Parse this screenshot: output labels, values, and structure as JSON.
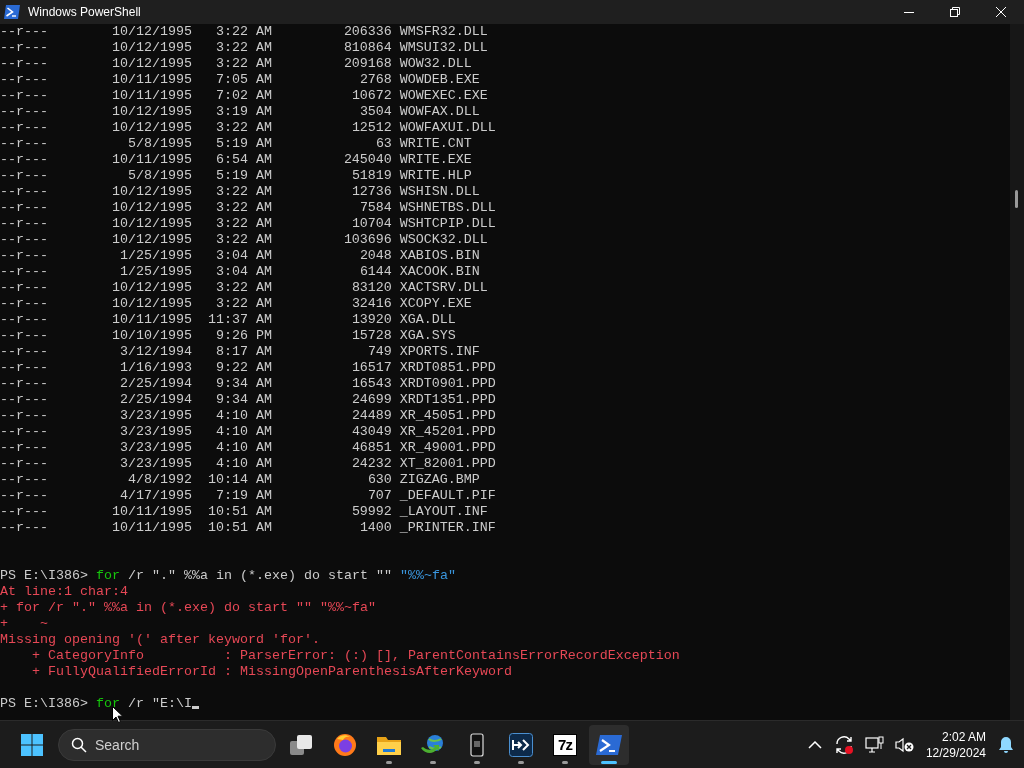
{
  "window": {
    "title": "Windows PowerShell"
  },
  "listing": [
    {
      "mode": "--r---",
      "date": "10/12/1995",
      "time": "3:22 AM",
      "length": "206336",
      "name": "WMSFR32.DLL"
    },
    {
      "mode": "--r---",
      "date": "10/12/1995",
      "time": "3:22 AM",
      "length": "810864",
      "name": "WMSUI32.DLL"
    },
    {
      "mode": "--r---",
      "date": "10/12/1995",
      "time": "3:22 AM",
      "length": "209168",
      "name": "WOW32.DLL"
    },
    {
      "mode": "--r---",
      "date": "10/11/1995",
      "time": "7:05 AM",
      "length": "2768",
      "name": "WOWDEB.EXE"
    },
    {
      "mode": "--r---",
      "date": "10/11/1995",
      "time": "7:02 AM",
      "length": "10672",
      "name": "WOWEXEC.EXE"
    },
    {
      "mode": "--r---",
      "date": "10/12/1995",
      "time": "3:19 AM",
      "length": "3504",
      "name": "WOWFAX.DLL"
    },
    {
      "mode": "--r---",
      "date": "10/12/1995",
      "time": "3:22 AM",
      "length": "12512",
      "name": "WOWFAXUI.DLL"
    },
    {
      "mode": "--r---",
      "date": "5/8/1995",
      "time": "5:19 AM",
      "length": "63",
      "name": "WRITE.CNT"
    },
    {
      "mode": "--r---",
      "date": "10/11/1995",
      "time": "6:54 AM",
      "length": "245040",
      "name": "WRITE.EXE"
    },
    {
      "mode": "--r---",
      "date": "5/8/1995",
      "time": "5:19 AM",
      "length": "51819",
      "name": "WRITE.HLP"
    },
    {
      "mode": "--r---",
      "date": "10/12/1995",
      "time": "3:22 AM",
      "length": "12736",
      "name": "WSHISN.DLL"
    },
    {
      "mode": "--r---",
      "date": "10/12/1995",
      "time": "3:22 AM",
      "length": "7584",
      "name": "WSHNETBS.DLL"
    },
    {
      "mode": "--r---",
      "date": "10/12/1995",
      "time": "3:22 AM",
      "length": "10704",
      "name": "WSHTCPIP.DLL"
    },
    {
      "mode": "--r---",
      "date": "10/12/1995",
      "time": "3:22 AM",
      "length": "103696",
      "name": "WSOCK32.DLL"
    },
    {
      "mode": "--r---",
      "date": "1/25/1995",
      "time": "3:04 AM",
      "length": "2048",
      "name": "XABIOS.BIN"
    },
    {
      "mode": "--r---",
      "date": "1/25/1995",
      "time": "3:04 AM",
      "length": "6144",
      "name": "XACOOK.BIN"
    },
    {
      "mode": "--r---",
      "date": "10/12/1995",
      "time": "3:22 AM",
      "length": "83120",
      "name": "XACTSRV.DLL"
    },
    {
      "mode": "--r---",
      "date": "10/12/1995",
      "time": "3:22 AM",
      "length": "32416",
      "name": "XCOPY.EXE"
    },
    {
      "mode": "--r---",
      "date": "10/11/1995",
      "time": "11:37 AM",
      "length": "13920",
      "name": "XGA.DLL"
    },
    {
      "mode": "--r---",
      "date": "10/10/1995",
      "time": "9:26 PM",
      "length": "15728",
      "name": "XGA.SYS"
    },
    {
      "mode": "--r---",
      "date": "3/12/1994",
      "time": "8:17 AM",
      "length": "749",
      "name": "XPORTS.INF"
    },
    {
      "mode": "--r---",
      "date": "1/16/1993",
      "time": "9:22 AM",
      "length": "16517",
      "name": "XRDT0851.PPD"
    },
    {
      "mode": "--r---",
      "date": "2/25/1994",
      "time": "9:34 AM",
      "length": "16543",
      "name": "XRDT0901.PPD"
    },
    {
      "mode": "--r---",
      "date": "2/25/1994",
      "time": "9:34 AM",
      "length": "24699",
      "name": "XRDT1351.PPD"
    },
    {
      "mode": "--r---",
      "date": "3/23/1995",
      "time": "4:10 AM",
      "length": "24489",
      "name": "XR_45051.PPD"
    },
    {
      "mode": "--r---",
      "date": "3/23/1995",
      "time": "4:10 AM",
      "length": "43049",
      "name": "XR_45201.PPD"
    },
    {
      "mode": "--r---",
      "date": "3/23/1995",
      "time": "4:10 AM",
      "length": "46851",
      "name": "XR_49001.PPD"
    },
    {
      "mode": "--r---",
      "date": "3/23/1995",
      "time": "4:10 AM",
      "length": "24232",
      "name": "XT_82001.PPD"
    },
    {
      "mode": "--r---",
      "date": "4/8/1992",
      "time": "10:14 AM",
      "length": "630",
      "name": "ZIGZAG.BMP"
    },
    {
      "mode": "--r---",
      "date": "4/17/1995",
      "time": "7:19 AM",
      "length": "707",
      "name": "_DEFAULT.PIF"
    },
    {
      "mode": "--r---",
      "date": "10/11/1995",
      "time": "10:51 AM",
      "length": "59992",
      "name": "_LAYOUT.INF"
    },
    {
      "mode": "--r---",
      "date": "10/11/1995",
      "time": "10:51 AM",
      "length": "1400",
      "name": "_PRINTER.INF"
    }
  ],
  "session": [
    {
      "kind": "command",
      "segments": [
        {
          "text": "PS E:\\I386> ",
          "color": "#cccccc"
        },
        {
          "text": "for",
          "color": "#16c60c"
        },
        {
          "text": " /r \".\" %%a in (*.exe) do start \"\" ",
          "color": "#cccccc"
        },
        {
          "text": "\"%%~fa\"",
          "color": "#3a96dd"
        }
      ]
    },
    {
      "kind": "error",
      "text": "At line:1 char:4"
    },
    {
      "kind": "error",
      "text": "+ for /r \".\" %%a in (*.exe) do start \"\" \"%%~fa\""
    },
    {
      "kind": "error",
      "text": "+    ~"
    },
    {
      "kind": "error",
      "text": "Missing opening '(' after keyword 'for'."
    },
    {
      "kind": "error",
      "text": "    + CategoryInfo          : ParserError: (:) [], ParentContainsErrorRecordException"
    },
    {
      "kind": "error",
      "text": "    + FullyQualifiedErrorId : MissingOpenParenthesisAfterKeyword"
    },
    {
      "kind": "command",
      "segments": [
        {
          "text": "PS E:\\I386> ",
          "color": "#cccccc"
        },
        {
          "text": "for",
          "color": "#16c60c"
        },
        {
          "text": " /r \"E:\\I",
          "color": "#cccccc"
        }
      ]
    }
  ],
  "taskbar": {
    "search": "Search",
    "apps": [
      {
        "kind": "task-view",
        "running": false,
        "active": false
      },
      {
        "kind": "browser",
        "running": false,
        "active": false
      },
      {
        "kind": "folder",
        "running": true,
        "active": false
      },
      {
        "kind": "download",
        "running": true,
        "active": false
      },
      {
        "kind": "phone",
        "running": true,
        "active": false
      },
      {
        "kind": "remote",
        "running": true,
        "active": false
      },
      {
        "kind": "archive",
        "label": "7z",
        "running": true,
        "active": false
      },
      {
        "kind": "terminal",
        "running": true,
        "active": true
      }
    ],
    "clock": {
      "time": "2:02 AM",
      "date": "12/29/2024"
    }
  }
}
